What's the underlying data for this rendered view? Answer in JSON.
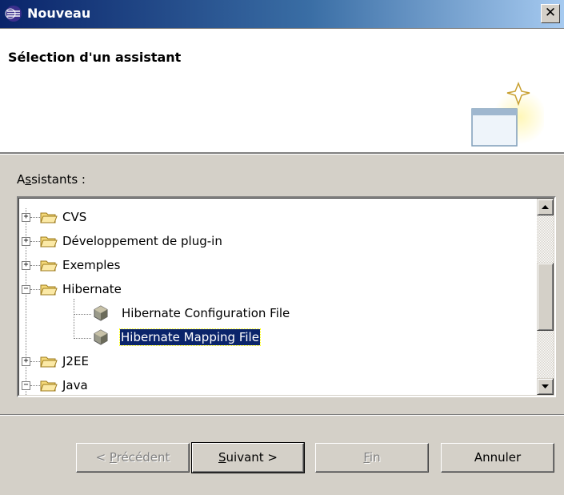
{
  "window": {
    "title": "Nouveau",
    "close_label": "✕"
  },
  "header": {
    "title": "Sélection d'un assistant"
  },
  "wizards": {
    "label_pre": "A",
    "label_mnemonic": "s",
    "label_post": "sistants :",
    "tree": [
      {
        "label": "CVS",
        "kind": "folder",
        "expander": "+"
      },
      {
        "label": "Développement de plug-in",
        "kind": "folder",
        "expander": "+"
      },
      {
        "label": "Exemples",
        "kind": "folder",
        "expander": "+"
      },
      {
        "label": "Hibernate",
        "kind": "folder",
        "expander": "−"
      },
      {
        "label": "Hibernate Configuration File",
        "kind": "file"
      },
      {
        "label": "Hibernate Mapping File",
        "kind": "file",
        "selected": true
      },
      {
        "label": "J2EE",
        "kind": "folder",
        "expander": "+"
      },
      {
        "label": "Java",
        "kind": "folder",
        "expander": "−"
      }
    ]
  },
  "buttons": {
    "back": {
      "pre": "< ",
      "mnemonic": "P",
      "post": "récédent",
      "enabled": false
    },
    "next": {
      "pre": "",
      "mnemonic": "S",
      "post": "uivant >",
      "enabled": true
    },
    "finish": {
      "pre": "",
      "mnemonic": "F",
      "post": "in",
      "enabled": false
    },
    "cancel": {
      "label": "Annuler",
      "enabled": true
    }
  },
  "colors": {
    "title_bar": "#0a246a",
    "selection": "#0a246a",
    "folder": "#f5d97a"
  }
}
